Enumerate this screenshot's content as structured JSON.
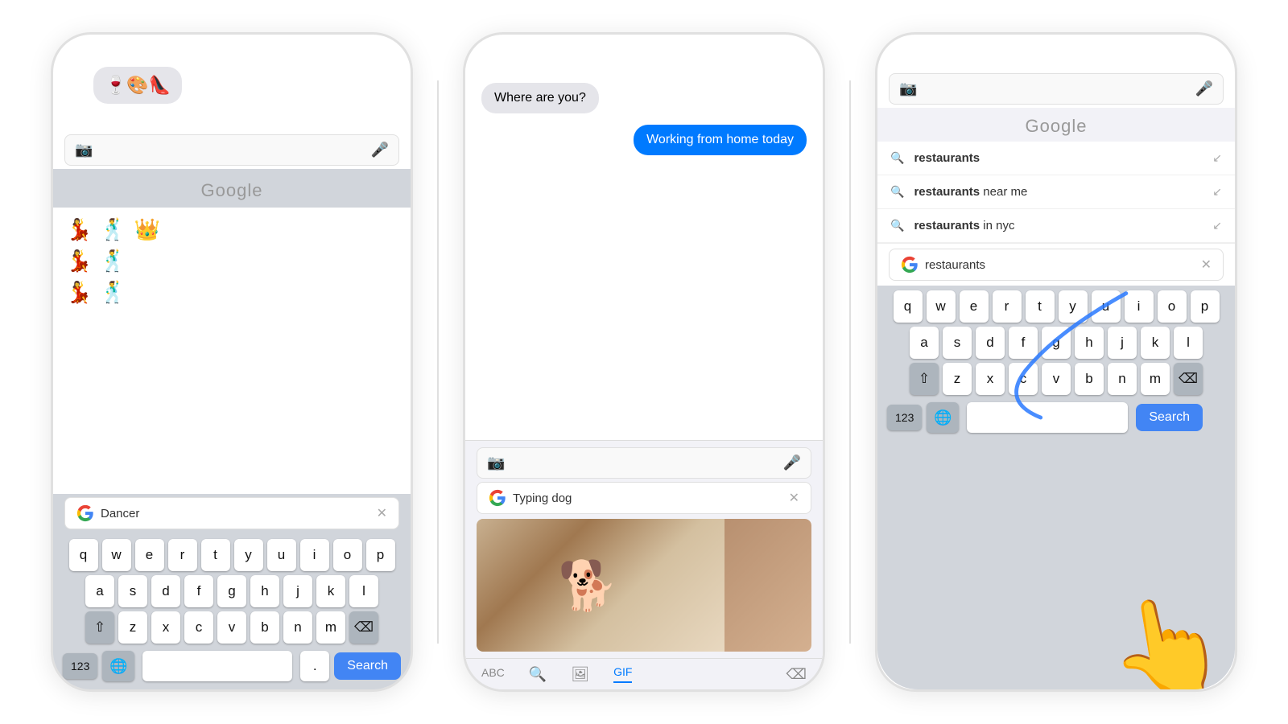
{
  "phone1": {
    "emoji_bubble": "🍷🎨👠",
    "google_label": "Google",
    "search_placeholder": "",
    "dancer_query": "Dancer",
    "emoji_rows": [
      [
        "💃",
        "🕺",
        "👑"
      ],
      [
        "💃",
        "🕺"
      ],
      [
        "💃",
        "🕺"
      ]
    ],
    "keyboard_rows": [
      [
        "q",
        "w",
        "e",
        "r",
        "t",
        "y",
        "u",
        "i",
        "o",
        "p"
      ],
      [
        "a",
        "s",
        "d",
        "f",
        "g",
        "h",
        "j",
        "k",
        "l"
      ],
      [
        "z",
        "x",
        "c",
        "v",
        "b",
        "n",
        "m"
      ]
    ],
    "num_label": "123",
    "period_label": ".",
    "search_button": "Search",
    "shift_label": "⇧",
    "delete_label": "⌫"
  },
  "phone2": {
    "bubble_received": "Where are you?",
    "bubble_sent": "Working from home today",
    "search_placeholder": "Typing dog",
    "tabs": {
      "abc": "ABC",
      "search_icon": "🔍",
      "image_icon": "🖼",
      "gif": "GIF",
      "delete": "⌫"
    }
  },
  "phone3": {
    "google_label": "Google",
    "search_query": "restaurants",
    "suggestions": [
      {
        "text": "restaurants",
        "bold": "restaurants"
      },
      {
        "text": "restaurants near me",
        "bold": "restaurants",
        "rest": " near me"
      },
      {
        "text": "restaurants in nyc",
        "bold": "restaurants",
        "rest": " in nyc"
      }
    ],
    "keyboard_rows": [
      [
        "q",
        "w",
        "e",
        "r",
        "t",
        "y",
        "u",
        "i",
        "o",
        "p"
      ],
      [
        "a",
        "s",
        "d",
        "f",
        "g",
        "h",
        "j",
        "k",
        "l"
      ],
      [
        "z",
        "x",
        "c",
        "v",
        "b",
        "n",
        "m"
      ]
    ],
    "num_label": "123",
    "search_button": "Search",
    "shift_label": "⇧",
    "delete_label": "⌫"
  },
  "colors": {
    "blue": "#4285f4",
    "ios_blue": "#007aff",
    "key_bg": "#ffffff",
    "keyboard_bg": "#d1d5db",
    "dark_key": "#adb5bd"
  }
}
